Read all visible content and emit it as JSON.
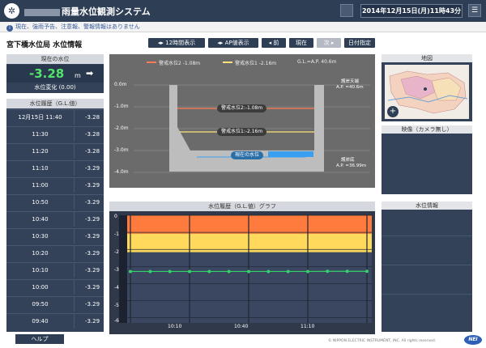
{
  "header": {
    "app_title": "雨量水位観測システム",
    "datetime": "2014年12月15日(月)11時43分",
    "menu_glyph": "☰",
    "logo_glyph": "✲"
  },
  "info_bar": {
    "message": "現在、強雨予告、注意報、警報情報はありません",
    "icon": "i"
  },
  "station": {
    "title": "宮下橋水位局 水位情報"
  },
  "toolbar": {
    "btn_12h": "◂▸ 12時間表示",
    "btn_ap": "◂▸ AP値表示",
    "btn_prev": "◂ 前",
    "btn_current": "現在",
    "btn_next": "次 ▸",
    "btn_date": "日付指定"
  },
  "current": {
    "header": "現在の水位",
    "value": "-3.28",
    "unit": "m",
    "trend_glyph": "➡",
    "change_label": "水位変化",
    "change_value": "(0.00)"
  },
  "history": {
    "header": "水位履歴（G.L.値）",
    "rows": [
      {
        "time": "12月15日 11:40",
        "value": "-3.28"
      },
      {
        "time": "11:30",
        "value": "-3.28"
      },
      {
        "time": "11:20",
        "value": "-3.28"
      },
      {
        "time": "11:10",
        "value": "-3.29"
      },
      {
        "time": "11:00",
        "value": "-3.29"
      },
      {
        "time": "10:50",
        "value": "-3.29"
      },
      {
        "time": "10:40",
        "value": "-3.29"
      },
      {
        "time": "10:30",
        "value": "-3.29"
      },
      {
        "time": "10:20",
        "value": "-3.29"
      },
      {
        "time": "10:10",
        "value": "-3.29"
      },
      {
        "time": "10:00",
        "value": "-3.29"
      },
      {
        "time": "09:50",
        "value": "-3.29"
      },
      {
        "time": "09:40",
        "value": "-3.29"
      }
    ]
  },
  "help_label": "ヘルプ",
  "cross_section": {
    "legend": [
      {
        "name": "警戒水位2",
        "value": "-1.08m",
        "color": "#ff7b54"
      },
      {
        "name": "警戒水位1",
        "value": "-2.16m",
        "color": "#ffe27a"
      },
      {
        "name": "G.L.=A.P.",
        "value": "40.6m",
        "color": ""
      }
    ],
    "y_labels": [
      "0.0m",
      "-1.0m",
      "-2.0m",
      "-3.0m",
      "-4.0m"
    ],
    "warning2_tag": "警戒水位2:-1.08m",
    "warning1_tag": "警戒水位1:-2.16m",
    "current_tag": "現在の水位",
    "top_label": "護岸天端",
    "top_ap": "A.P. =40.6m",
    "bottom_label": "護岸底",
    "bottom_ap": "A.P. =36.99m"
  },
  "map": {
    "header": "地図",
    "zoom_glyph": "+"
  },
  "camera": {
    "header": "映像（カメラ無し）"
  },
  "water_info": {
    "header": "水位情報"
  },
  "graph": {
    "header": "水位履歴（G.L.値）グラフ",
    "y_labels": [
      "0",
      "-1",
      "-2",
      "-3",
      "-4",
      "-5",
      "-6"
    ],
    "x_labels": [
      "10:10",
      "10:40",
      "11:10"
    ]
  },
  "chart_data": {
    "type": "line",
    "title": "水位履歴（G.L.値）グラフ",
    "xlabel": "",
    "ylabel": "",
    "ylim": [
      -6.3,
      0
    ],
    "x": [
      "09:40",
      "09:50",
      "10:00",
      "10:10",
      "10:20",
      "10:30",
      "10:40",
      "10:50",
      "11:00",
      "11:10",
      "11:20",
      "11:30",
      "11:40"
    ],
    "series": [
      {
        "name": "",
        "values": [
          -3.29,
          -3.29,
          -3.29,
          -3.29,
          -3.29,
          -3.29,
          -3.29,
          -3.29,
          -3.29,
          -3.29,
          -3.28,
          -3.28,
          -3.28
        ],
        "color": "#34d36a"
      }
    ],
    "bands": [
      {
        "from": 0,
        "to": -1.08,
        "color": "#ff7b3d"
      },
      {
        "from": -1.08,
        "to": -2.16,
        "color": "#ffd95c"
      }
    ],
    "grid": true
  },
  "footer": {
    "copyright": "© NIPPON ELECTRIC INSTRUMENT, INC. All rights reserved.",
    "logo_text": "NEI"
  }
}
